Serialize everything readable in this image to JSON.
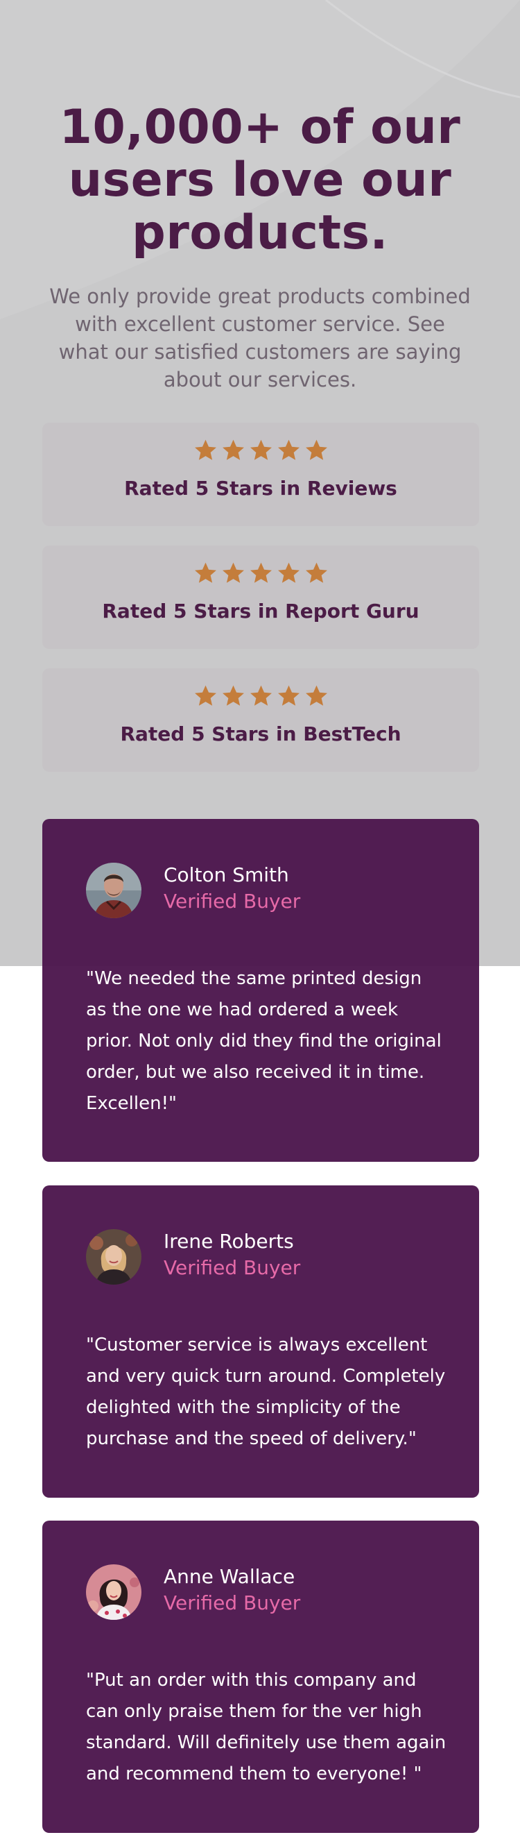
{
  "hero": {
    "heading_lines": [
      "10,000+ of our",
      "users love our",
      "products."
    ],
    "intro": "We only provide great products combined with excellent customer service. See what our satisfied customers are saying about our services."
  },
  "ratings": [
    {
      "stars": 5,
      "label": "Rated 5 Stars in Reviews"
    },
    {
      "stars": 5,
      "label": "Rated 5 Stars in Report Guru"
    },
    {
      "stars": 5,
      "label": "Rated 5 Stars in BestTech"
    }
  ],
  "testimonials": [
    {
      "name": "Colton Smith",
      "status": "Verified Buyer",
      "quote": "\"We needed the same printed design as the one we had ordered a week prior. Not only did they find the original order, but we also received it in time. Excellen!\""
    },
    {
      "name": "Irene Roberts",
      "status": "Verified Buyer",
      "quote": "\"Customer service is always excellent and very quick turn around. Completely delighted with the simplicity of the purchase and the speed of delivery.\""
    },
    {
      "name": "Anne Wallace",
      "status": "Verified Buyer",
      "quote": "\"Put an order with this company and can only praise them for the ver high standard. Will definitely use them again and recommend them to everyone! \""
    }
  ],
  "colors": {
    "accent": "#4b1c46",
    "star": "#c47d3b",
    "verified": "#e66aa8",
    "card_bg": "#4c164d",
    "rating_bg": "#c6c3c6"
  },
  "icons": {
    "star": "star-icon"
  }
}
